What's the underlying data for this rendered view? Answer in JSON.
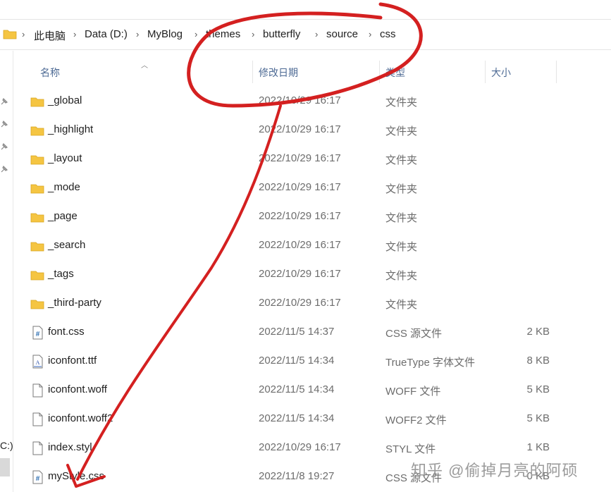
{
  "breadcrumb": {
    "items": [
      "此电脑",
      "Data (D:)",
      "MyBlog",
      "themes",
      "butterfly",
      "source",
      "css"
    ],
    "separator": "›"
  },
  "columns": {
    "name": "名称",
    "modified": "修改日期",
    "type": "类型",
    "size": "大小"
  },
  "nav_pane": {
    "drive_fragment": "C:)"
  },
  "files": [
    {
      "name": "_global",
      "modified": "2022/10/29 16:17",
      "type": "文件夹",
      "size": "",
      "icon": "folder-icon"
    },
    {
      "name": "_highlight",
      "modified": "2022/10/29 16:17",
      "type": "文件夹",
      "size": "",
      "icon": "folder-icon"
    },
    {
      "name": "_layout",
      "modified": "2022/10/29 16:17",
      "type": "文件夹",
      "size": "",
      "icon": "folder-icon"
    },
    {
      "name": "_mode",
      "modified": "2022/10/29 16:17",
      "type": "文件夹",
      "size": "",
      "icon": "folder-icon"
    },
    {
      "name": "_page",
      "modified": "2022/10/29 16:17",
      "type": "文件夹",
      "size": "",
      "icon": "folder-icon"
    },
    {
      "name": "_search",
      "modified": "2022/10/29 16:17",
      "type": "文件夹",
      "size": "",
      "icon": "folder-icon"
    },
    {
      "name": "_tags",
      "modified": "2022/10/29 16:17",
      "type": "文件夹",
      "size": "",
      "icon": "folder-icon"
    },
    {
      "name": "_third-party",
      "modified": "2022/10/29 16:17",
      "type": "文件夹",
      "size": "",
      "icon": "folder-icon"
    },
    {
      "name": "font.css",
      "modified": "2022/11/5 14:37",
      "type": "CSS 源文件",
      "size": "2 KB",
      "icon": "css-file-icon"
    },
    {
      "name": "iconfont.ttf",
      "modified": "2022/11/5 14:34",
      "type": "TrueType 字体文件",
      "size": "8 KB",
      "icon": "font-file-icon"
    },
    {
      "name": "iconfont.woff",
      "modified": "2022/11/5 14:34",
      "type": "WOFF 文件",
      "size": "5 KB",
      "icon": "file-icon"
    },
    {
      "name": "iconfont.woff2",
      "modified": "2022/11/5 14:34",
      "type": "WOFF2 文件",
      "size": "5 KB",
      "icon": "file-icon"
    },
    {
      "name": "index.styl",
      "modified": "2022/10/29 16:17",
      "type": "STYL 文件",
      "size": "1 KB",
      "icon": "file-icon"
    },
    {
      "name": "myStyle.css",
      "modified": "2022/11/8 19:27",
      "type": "CSS 源文件",
      "size": "0 KB",
      "icon": "css-file-icon"
    }
  ],
  "watermark": "知乎 @偷掉月亮的阿硕",
  "colors": {
    "folder": "#f5c542",
    "header_text": "#4d6a94",
    "annotation": "#d42020"
  }
}
